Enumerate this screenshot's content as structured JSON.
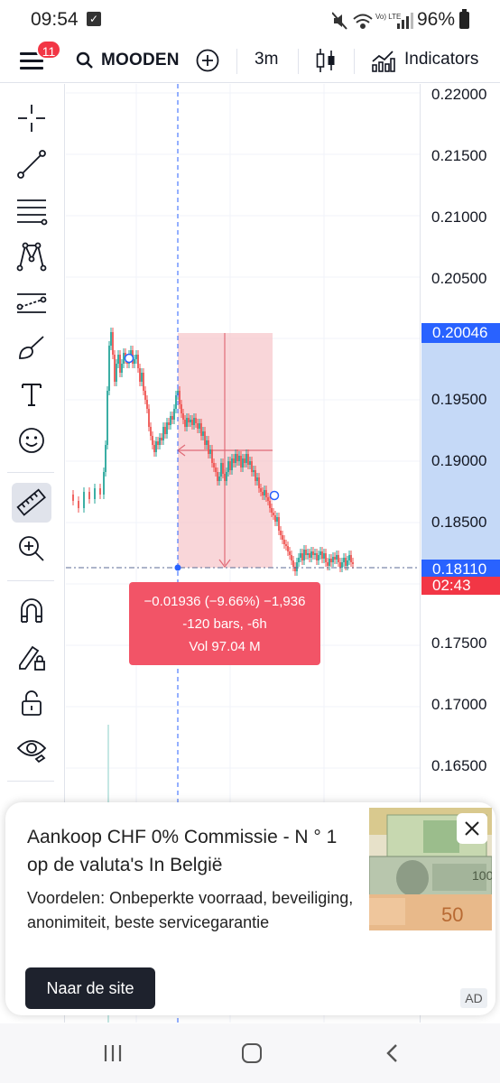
{
  "status_bar": {
    "time": "09:54",
    "battery": "96%",
    "network_label": "Vo) LTE"
  },
  "toolbar": {
    "notification_count": "11",
    "symbol": "MOODEN",
    "interval": "3m",
    "indicators_label": "Indicators"
  },
  "left_tools": [
    "crosshair-icon",
    "trend-line-icon",
    "fib-retracement-icon",
    "pattern-icon",
    "forecast-icon",
    "brush-icon",
    "text-icon",
    "emoji-icon",
    "ruler-icon",
    "zoom-in-icon",
    "magnet-icon",
    "lock-drawing-icon",
    "unlock-icon",
    "eye-icon"
  ],
  "price_axis": {
    "ticks": [
      "0.22000",
      "0.21500",
      "0.21000",
      "0.20500",
      "0.19500",
      "0.19000",
      "0.18500",
      "0.17500",
      "0.17000",
      "0.16500"
    ],
    "measure_top_label": "0.20046",
    "current_price_label": "0.18110",
    "countdown_label": "02:43",
    "range_color": "#c5d9f7",
    "current_color": "#2962ff",
    "countdown_color": "#f23645"
  },
  "measure": {
    "line1": "−0.01936 (−9.66%) −1,936",
    "line2": "-120 bars, -6h",
    "line3": "Vol 97.04 M",
    "box_color": "#f25467",
    "zone_color": "#f7c8cc"
  },
  "ad": {
    "title": "Aankoop CHF 0% Commissie - N ° 1 op de valuta's In België",
    "body": "Voordelen: Onbeperkte voorraad, beveiliging, anonimiteit, beste servicegarantie",
    "button_label": "Naar de site",
    "tag": "AD"
  },
  "colors": {
    "up": "#26a69a",
    "down": "#ef5350",
    "accent": "#2962ff"
  }
}
